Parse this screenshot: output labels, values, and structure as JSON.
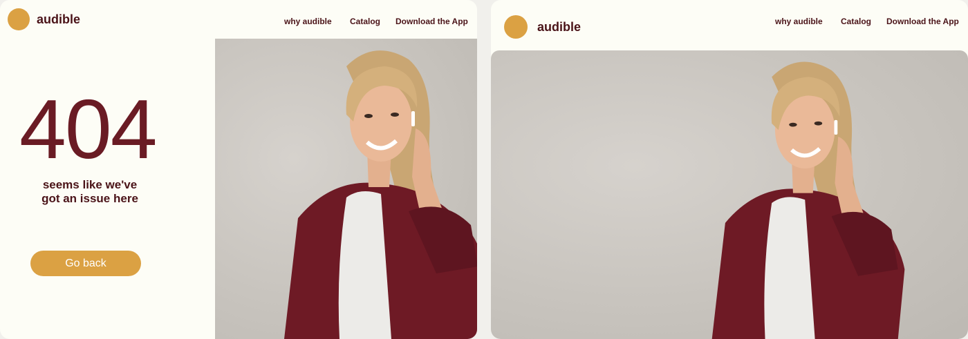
{
  "brand": {
    "name": "audible",
    "accent": "#dba143",
    "text_color": "#4a1318",
    "error_color": "#6a1b24"
  },
  "nav": {
    "why": "why audible",
    "catalog": "Catalog",
    "download": "Download the App"
  },
  "error_page": {
    "code": "404",
    "line1": "seems like we've",
    "line2": "got an issue here",
    "button": "Go back"
  },
  "photo": {
    "subject": "smiling woman with earbud in red shirt"
  }
}
